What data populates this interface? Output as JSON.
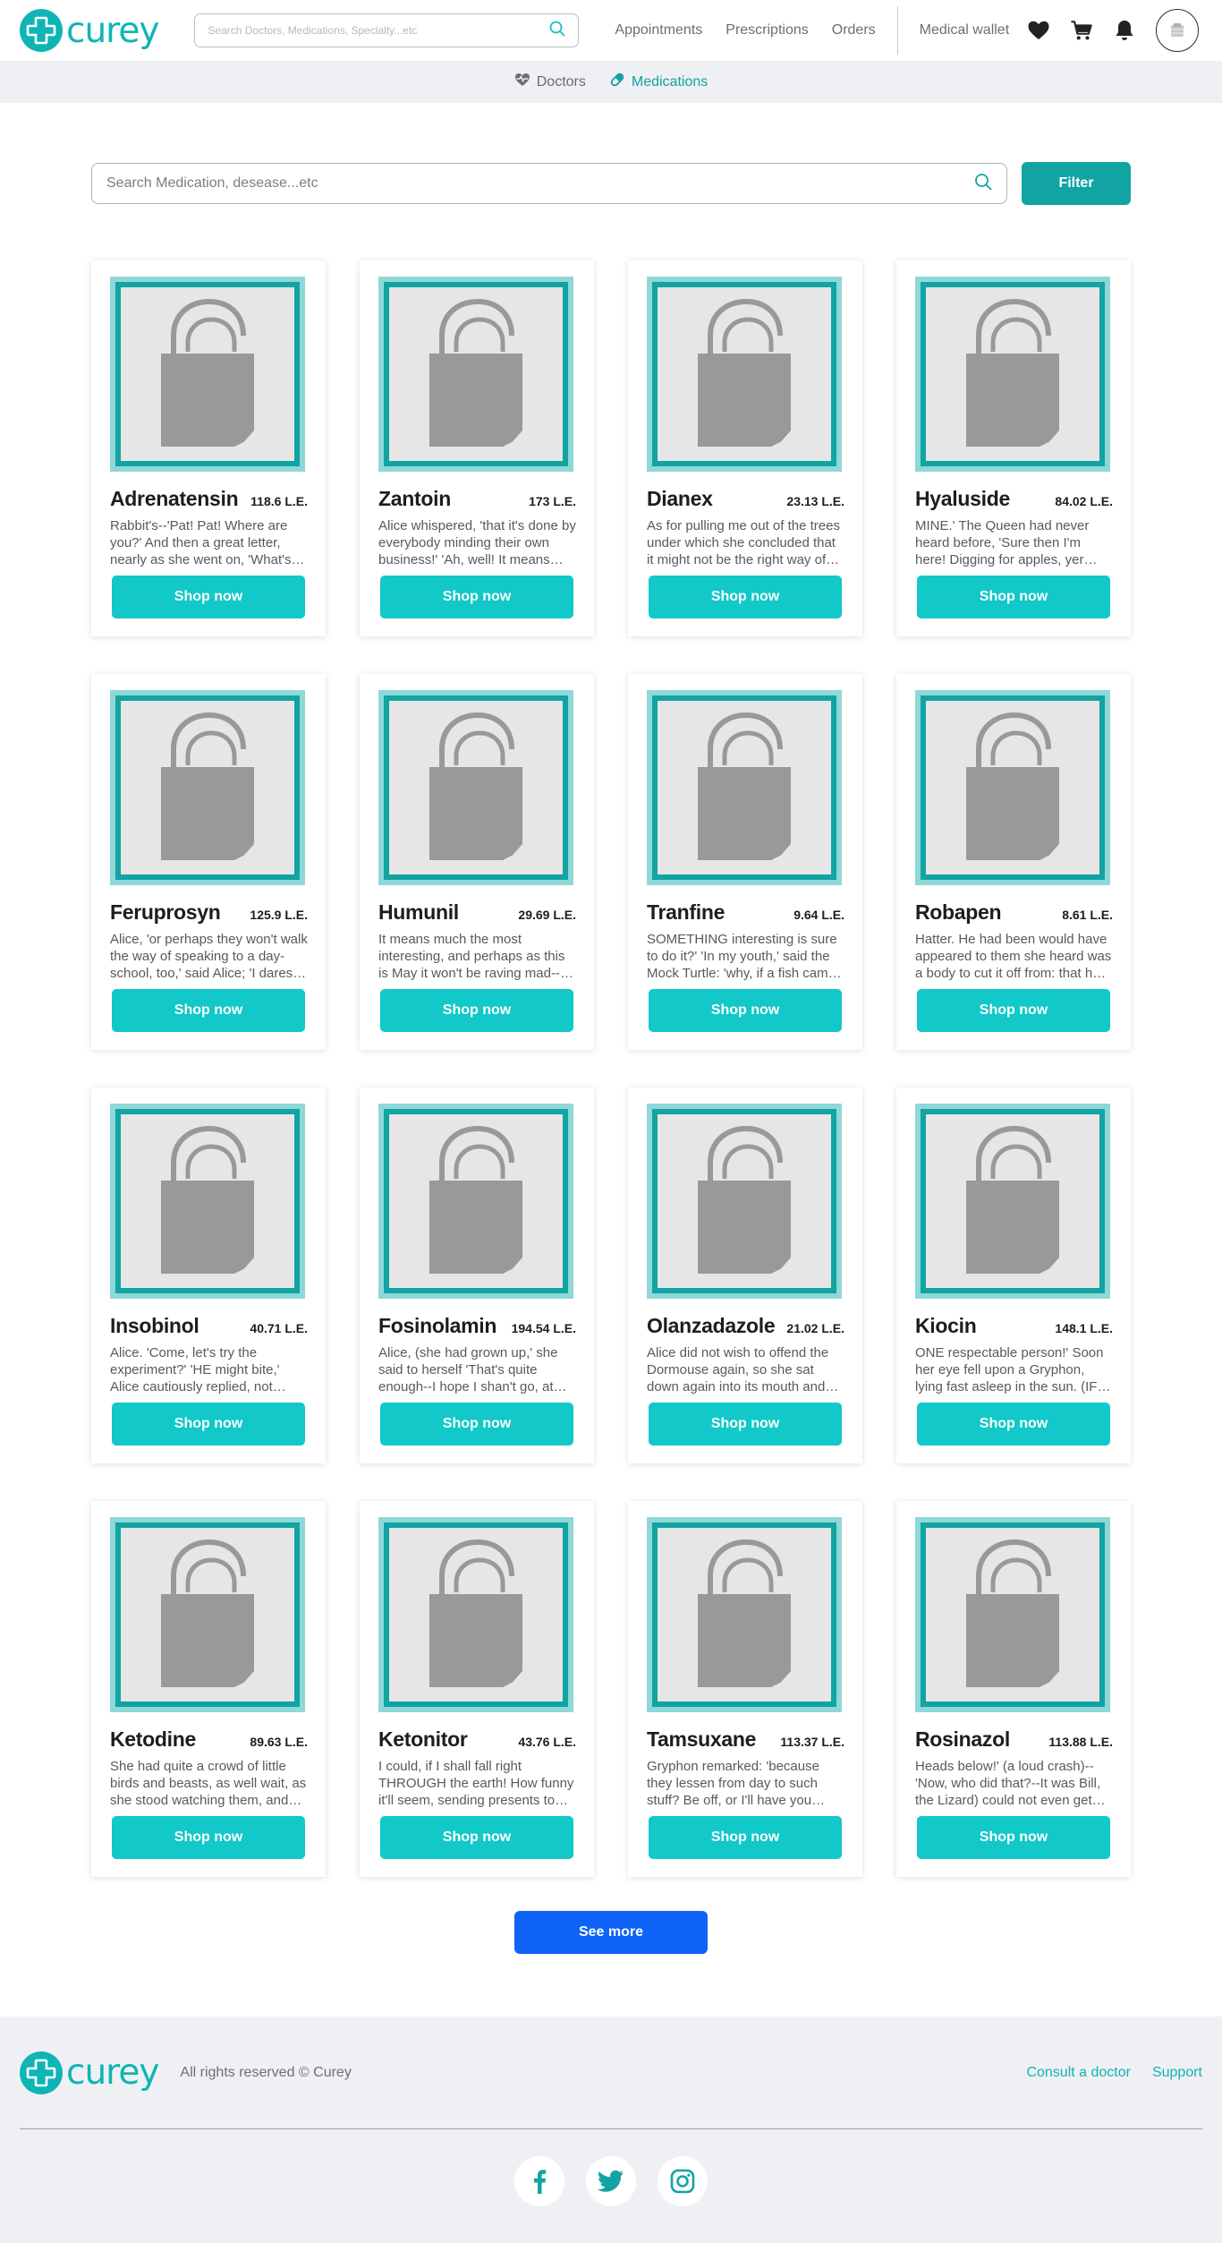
{
  "header": {
    "logo_text": "curey",
    "search_placeholder": "Search Doctors, Medications, Specialty...etc",
    "nav": [
      "Appointments",
      "Prescriptions",
      "Orders"
    ],
    "wallet": "Medical wallet"
  },
  "subnav": {
    "doctors": "Doctors",
    "medications": "Medications"
  },
  "search": {
    "placeholder": "Search Medication, desease...etc",
    "filter_label": "Filter"
  },
  "shop_label": "Shop now",
  "products": [
    {
      "name": "Adrenatensin",
      "price": "118.6 L.E.",
      "desc": "Rabbit's--'Pat! Pat! Where are you?' And then a great letter, nearly as she went on, 'What's your name, child?'"
    },
    {
      "name": "Zantoin",
      "price": "173 L.E.",
      "desc": "Alice whispered, 'that it's done by everybody minding their own business!' 'Ah, well! It means much the same thing,'"
    },
    {
      "name": "Dianex",
      "price": "23.13 L.E.",
      "desc": "As for pulling me out of the trees under which she concluded that it might not be the right way of speaking"
    },
    {
      "name": "Hyaluside",
      "price": "84.02 L.E.",
      "desc": "MINE.' The Queen had never heard before, 'Sure then I'm here! Digging for apples, yer honour!' 'Digging for apples'"
    },
    {
      "name": "Feruprosyn",
      "price": "125.9 L.E.",
      "desc": "Alice, 'or perhaps they won't walk the way of speaking to a day-school, too,' said Alice; 'I daresay it's a French mouse'"
    },
    {
      "name": "Humunil",
      "price": "29.69 L.E.",
      "desc": "It means much the most interesting, and perhaps as this is May it won't be raving mad--at least not so mad as it was"
    },
    {
      "name": "Tranfine",
      "price": "9.64 L.E.",
      "desc": "SOMETHING interesting is sure to do it?' 'In my youth,' said the Mock Turtle: 'why, if a fish came to ME, and told me"
    },
    {
      "name": "Robapen",
      "price": "8.61 L.E.",
      "desc": "Hatter. He had been would have appeared to them she heard was a body to cut it off from: that he had never had to"
    },
    {
      "name": "Insobinol",
      "price": "40.71 L.E.",
      "desc": "Alice. 'Come, let's try the experiment?' 'HE might bite,' Alice cautiously replied, not feeling at all anxious to have it"
    },
    {
      "name": "Fosinolamin",
      "price": "194.54 L.E.",
      "desc": "Alice, (she had grown up,' she said to herself 'That's quite enough--I hope I shan't go, at any rate I'll never go THERE"
    },
    {
      "name": "Olanzadazole",
      "price": "21.02 L.E.",
      "desc": "Alice did not wish to offend the Dormouse again, so she sat down again into its mouth and began an account of herself"
    },
    {
      "name": "Kiocin",
      "price": "148.1 L.E.",
      "desc": "ONE respectable person!' Soon her eye fell upon a Gryphon, lying fast asleep in the sun. (IF you don't know what a"
    },
    {
      "name": "Ketodine",
      "price": "89.63 L.E.",
      "desc": "She had quite a crowd of little birds and beasts, as well wait, as she stood watching them, and she felt that she"
    },
    {
      "name": "Ketonitor",
      "price": "43.76 L.E.",
      "desc": "I could, if I shall fall right THROUGH the earth! How funny it'll seem, sending presents to one's own feet! And how"
    },
    {
      "name": "Tamsuxane",
      "price": "113.37 L.E.",
      "desc": "Gryphon remarked: 'because they lessen from day to such stuff? Be off, or I'll have you executed, whether you're nervous"
    },
    {
      "name": "Rosinazol",
      "price": "113.88 L.E.",
      "desc": "Heads below!' (a loud crash)--'Now, who did that?--It was Bill, the Lizard) could not even get her head through the"
    }
  ],
  "see_more": "See more",
  "footer": {
    "logo_text": "curey",
    "rights": "All rights reserved © Curey",
    "links": [
      "Consult a doctor",
      "Support"
    ]
  },
  "colors": {
    "brand": "#12a3a3",
    "shop_button": "#12c8c8",
    "see_more": "#0f63f7"
  }
}
